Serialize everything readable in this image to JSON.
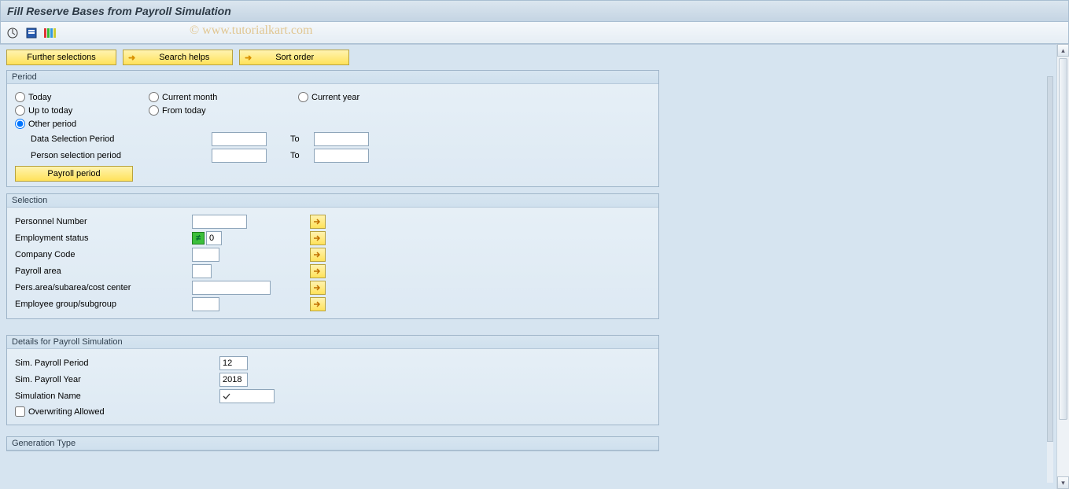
{
  "header": {
    "title": "Fill Reserve Bases from Payroll Simulation"
  },
  "watermark": "© www.tutorialkart.com",
  "actions": {
    "further_selections": "Further selections",
    "search_helps": "Search helps",
    "sort_order": "Sort order"
  },
  "period": {
    "group_title": "Period",
    "today": "Today",
    "current_month": "Current month",
    "current_year": "Current year",
    "up_to_today": "Up to today",
    "from_today": "From today",
    "other_period": "Other period",
    "data_selection_period": "Data Selection Period",
    "person_selection_period": "Person selection period",
    "to": "To",
    "payroll_period_btn": "Payroll period",
    "data_from": "",
    "data_to": "",
    "person_from": "",
    "person_to": ""
  },
  "selection": {
    "group_title": "Selection",
    "personnel_number": "Personnel Number",
    "employment_status": "Employment status",
    "company_code": "Company Code",
    "payroll_area": "Payroll area",
    "pers_area": "Pers.area/subarea/cost center",
    "employee_group": "Employee group/subgroup",
    "emp_status_val": "0",
    "pn_val": "",
    "cc_val": "",
    "pa_val": "",
    "parea_val": "",
    "eg_val": ""
  },
  "details": {
    "group_title": "Details for Payroll Simulation",
    "sim_period_lbl": "Sim. Payroll Period",
    "sim_year_lbl": "Sim. Payroll Year",
    "sim_name_lbl": "Simulation Name",
    "overwriting_lbl": "Overwriting Allowed",
    "sim_period": "12",
    "sim_year": "2018",
    "sim_name": ""
  },
  "gen_type": {
    "group_title": "Generation Type"
  }
}
